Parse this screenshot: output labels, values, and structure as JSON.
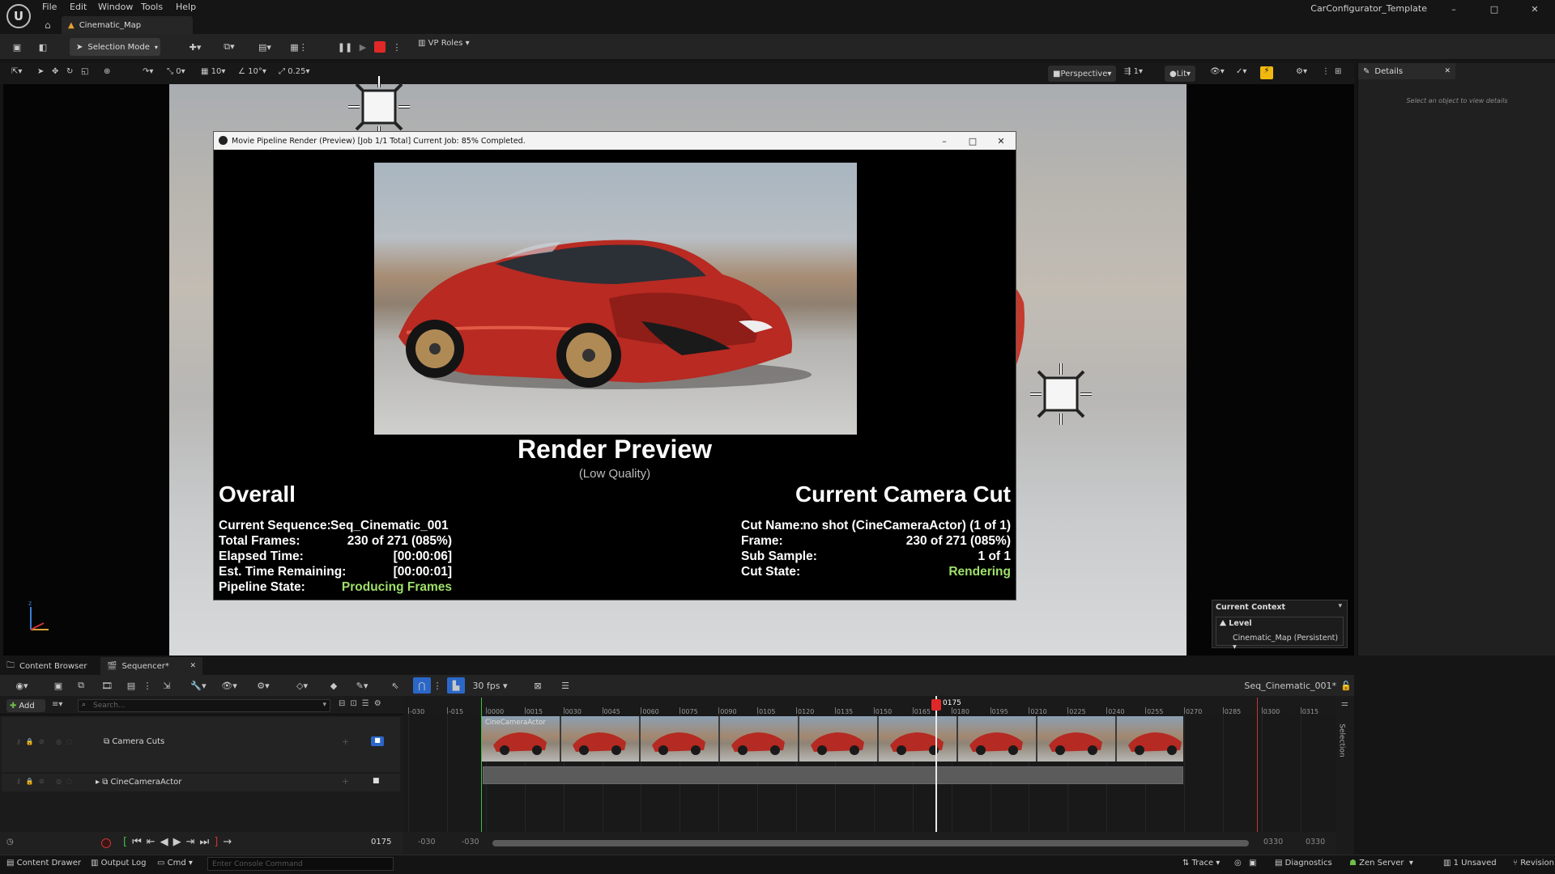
{
  "app": {
    "menu": [
      "File",
      "Edit",
      "Window",
      "Tools",
      "Help"
    ],
    "project_name": "CarConfigurator_Template",
    "map_tab": "Cinematic_Map",
    "window_controls": [
      "–",
      "□",
      "✕"
    ]
  },
  "toolbar": {
    "selection_mode": "Selection Mode",
    "vp_roles": "VP Roles"
  },
  "viewport_toolbar": {
    "snap_rot": "0",
    "grid": "10",
    "angle": "10°",
    "scale": "0.25",
    "perspective": "Perspective",
    "cameras": "1",
    "lit": "Lit"
  },
  "details": {
    "tab": "Details",
    "hint": "Select an object to view details"
  },
  "context": {
    "title": "Current Context",
    "level_label": "Level",
    "level_value": "Cinematic_Map (Persistent)"
  },
  "render_window": {
    "title": "Movie Pipeline Render (Preview) [Job 1/1 Total] Current Job: 85% Completed.",
    "heading": "Render Preview",
    "subheading": "(Low Quality)",
    "overall": {
      "heading": "Overall",
      "rows": [
        {
          "label": "Current Sequence:",
          "value": "Seq_Cinematic_001"
        },
        {
          "label": "Total Frames:",
          "value": "230 of 271 (085%)"
        },
        {
          "label": "Elapsed Time:",
          "value": "[00:00:06]"
        },
        {
          "label": "Est. Time Remaining:",
          "value": "[00:00:01]"
        },
        {
          "label": "Pipeline State:",
          "value": "Producing Frames"
        }
      ]
    },
    "camera_cut": {
      "heading": "Current Camera Cut",
      "rows": [
        {
          "label": "Cut Name:",
          "value": "no shot (CineCameraActor) (1 of 1)"
        },
        {
          "label": "Frame:",
          "value": "230 of 271 (085%)"
        },
        {
          "label": "Sub Sample:",
          "value": "1 of 1"
        },
        {
          "label": "Cut State:",
          "value": "Rendering"
        }
      ]
    },
    "progress": 0.85
  },
  "bottom_tabs": {
    "content_browser": "Content Browser",
    "sequencer": "Sequencer*"
  },
  "sequencer": {
    "add": "Add",
    "search_placeholder": "Search...",
    "fps": "30 fps",
    "sequence_name": "Seq_Cinematic_001*",
    "tracks": [
      "Camera Cuts",
      "CineCameraActor"
    ],
    "thumb_label": "CineCameraActor",
    "ticks": [
      "-030",
      "-015",
      "0000",
      "0015",
      "0030",
      "0045",
      "0060",
      "0075",
      "0090",
      "0105",
      "0120",
      "0135",
      "0150",
      "0165",
      "0180",
      "0195",
      "0210",
      "0225",
      "0240",
      "0255",
      "0270",
      "0285",
      "0300",
      "0315"
    ],
    "playhead": "0175",
    "current_frame": "0175",
    "range_start_a": "-030",
    "range_start_b": "-030",
    "range_end_a": "0330",
    "range_end_b": "0330",
    "side_label": "Selection"
  },
  "status_bar": {
    "content_drawer": "Content Drawer",
    "output_log": "Output Log",
    "cmd": "Cmd",
    "console_placeholder": "Enter Console Command",
    "trace": "Trace",
    "diagnostics": "Diagnostics",
    "zen": "Zen Server",
    "unsaved": "1 Unsaved",
    "revision": "Revision"
  }
}
